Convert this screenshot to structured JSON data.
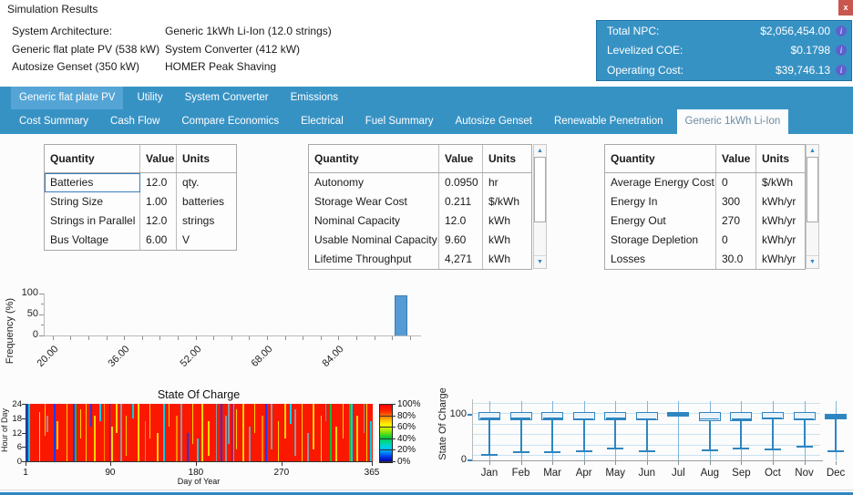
{
  "window": {
    "title": "Simulation Results",
    "close_label": "x"
  },
  "architecture": {
    "rows_left": [
      "System Architecture:",
      "Generic flat plate PV (538 kW)",
      "Autosize Genset (350 kW)"
    ],
    "rows_right": [
      "Generic 1kWh Li-Ion (12.0 strings)",
      "System Converter (412 kW)",
      "HOMER Peak Shaving"
    ]
  },
  "summary": {
    "rows": [
      {
        "label": "Total NPC:",
        "value": "$2,056,454.00"
      },
      {
        "label": "Levelized COE:",
        "value": "$0.1798"
      },
      {
        "label": "Operating Cost:",
        "value": "$39,746.13"
      }
    ],
    "info_icon": "i",
    "accent_color": "#3792C4"
  },
  "tabs": {
    "row1": [
      {
        "label": "Generic flat plate PV",
        "selected": true
      },
      {
        "label": "Utility",
        "selected": false
      },
      {
        "label": "System Converter",
        "selected": false
      },
      {
        "label": "Emissions",
        "selected": false
      }
    ],
    "row2": [
      {
        "label": "Cost Summary",
        "selected": false
      },
      {
        "label": "Cash Flow",
        "selected": false
      },
      {
        "label": "Compare Economics",
        "selected": false
      },
      {
        "label": "Electrical",
        "selected": false
      },
      {
        "label": "Fuel Summary",
        "selected": false
      },
      {
        "label": "Autosize Genset",
        "selected": false
      },
      {
        "label": "Renewable Penetration",
        "selected": false
      },
      {
        "label": "Generic 1kWh Li-Ion",
        "selected": true
      }
    ]
  },
  "tables": [
    {
      "headers": [
        "Quantity",
        "Value",
        "Units"
      ],
      "rows": [
        [
          "Batteries",
          "12.0",
          "qty."
        ],
        [
          "String Size",
          "1.00",
          "batteries"
        ],
        [
          "Strings in Parallel",
          "12.0",
          "strings"
        ],
        [
          "Bus Voltage",
          "6.00",
          "V"
        ]
      ],
      "focused_cell": [
        0,
        0
      ],
      "scrollbar": false
    },
    {
      "headers": [
        "Quantity",
        "Value",
        "Units"
      ],
      "rows": [
        [
          "Autonomy",
          "0.0950",
          "hr"
        ],
        [
          "Storage Wear Cost",
          "0.211",
          "$/kWh"
        ],
        [
          "Nominal Capacity",
          "12.0",
          "kWh"
        ],
        [
          "Usable Nominal Capacity",
          "9.60",
          "kWh"
        ],
        [
          "Lifetime Throughput",
          "4,271",
          "kWh"
        ]
      ],
      "scrollbar": true
    },
    {
      "headers": [
        "Quantity",
        "Value",
        "Units"
      ],
      "rows": [
        [
          "Average Energy Cost",
          "0",
          "$/kWh"
        ],
        [
          "Energy In",
          "300",
          "kWh/yr"
        ],
        [
          "Energy Out",
          "270",
          "kWh/yr"
        ],
        [
          "Storage Depletion",
          "0",
          "kWh/yr"
        ],
        [
          "Losses",
          "30.0",
          "kWh/yr"
        ]
      ],
      "scrollbar": true
    }
  ],
  "chart_data": [
    {
      "type": "bar",
      "subtype": "histogram",
      "title": "",
      "ylabel": "Frequency (%)",
      "xlabel": "",
      "ylim": [
        0,
        100
      ],
      "y_ticks": [
        0,
        50,
        100
      ],
      "x_range": [
        18,
        102
      ],
      "x_tick_step": 4,
      "x_tick_labels": [
        "20.00",
        "36.00",
        "52.00",
        "68.00",
        "84.00"
      ],
      "x_tick_label_values": [
        20,
        36,
        52,
        68,
        84
      ],
      "bars": [
        {
          "x_center": 98,
          "bin_width": 2.7,
          "value": 95
        }
      ],
      "bar_color": "#579BD5"
    },
    {
      "type": "heatmap",
      "title": "State Of Charge",
      "xlabel": "Day of Year",
      "ylabel": "Hour of Day",
      "x_ticks": [
        1,
        90,
        180,
        270,
        365
      ],
      "y_ticks": [
        0,
        6,
        12,
        18,
        24
      ],
      "legend_labels": [
        "100%",
        "80%",
        "60%",
        "40%",
        "20%",
        "0%"
      ],
      "base_value": "~100% state of charge most of year",
      "base_color": "#FB1800",
      "palette": {
        "Y": "#FFD400",
        "O": "#FF8A00",
        "B": "#2438E8",
        "C": "#00CFE8",
        "G": "#18B83C",
        "N": "#8C98A4"
      },
      "streaks": [
        [
          1,
          "B",
          0,
          1
        ],
        [
          3,
          "C",
          0,
          1
        ],
        [
          14,
          "Y",
          0.15,
          1
        ],
        [
          20,
          "Y",
          0,
          0.55
        ],
        [
          22,
          "N",
          0.2,
          0.5
        ],
        [
          30,
          "B",
          0,
          1
        ],
        [
          33,
          "Y",
          0.3,
          0.8
        ],
        [
          43,
          "Y",
          0,
          1
        ],
        [
          50,
          "B",
          0,
          1
        ],
        [
          52,
          "G",
          0,
          1
        ],
        [
          57,
          "Y",
          0.1,
          0.6
        ],
        [
          63,
          "Y",
          0,
          1
        ],
        [
          68,
          "B",
          0,
          0.4
        ],
        [
          72,
          "Y",
          0.2,
          1
        ],
        [
          78,
          "C",
          0,
          0.3
        ],
        [
          82,
          "O",
          0,
          1
        ],
        [
          88,
          "B",
          0,
          1
        ],
        [
          90,
          "Y",
          0.4,
          1
        ],
        [
          95,
          "Y",
          0,
          0.5
        ],
        [
          100,
          "N",
          0,
          1
        ],
        [
          105,
          "Y",
          0.2,
          0.9
        ],
        [
          112,
          "C",
          0,
          0.25
        ],
        [
          118,
          "Y",
          0,
          1
        ],
        [
          125,
          "N",
          0.3,
          1
        ],
        [
          130,
          "Y",
          0,
          0.6
        ],
        [
          138,
          "Y",
          0.5,
          1
        ],
        [
          145,
          "C",
          0,
          1
        ],
        [
          150,
          "Y",
          0,
          0.4
        ],
        [
          158,
          "O",
          0.2,
          1
        ],
        [
          163,
          "N",
          0,
          1
        ],
        [
          170,
          "B",
          0.5,
          1
        ],
        [
          175,
          "Y",
          0,
          0.7
        ],
        [
          180,
          "C",
          0.6,
          1
        ],
        [
          185,
          "Y",
          0,
          1
        ],
        [
          192,
          "Y",
          0.3,
          0.9
        ],
        [
          200,
          "N",
          0,
          1
        ],
        [
          205,
          "B",
          0,
          1
        ],
        [
          210,
          "N",
          0.2,
          1
        ],
        [
          213,
          "N",
          0,
          0.7
        ],
        [
          216,
          "B",
          0,
          1
        ],
        [
          218,
          "N",
          0,
          1
        ],
        [
          221,
          "Y",
          0.1,
          0.8
        ],
        [
          228,
          "Y",
          0,
          1
        ],
        [
          235,
          "N",
          0.4,
          1
        ],
        [
          240,
          "Y",
          0,
          0.5
        ],
        [
          248,
          "O",
          0.2,
          1
        ],
        [
          252,
          "B",
          0,
          1
        ],
        [
          258,
          "N",
          0,
          0.8
        ],
        [
          265,
          "Y",
          0.3,
          1
        ],
        [
          272,
          "Y",
          0,
          0.6
        ],
        [
          278,
          "C",
          0,
          0.35
        ],
        [
          283,
          "N",
          0.1,
          0.9
        ],
        [
          290,
          "Y",
          0,
          1
        ],
        [
          296,
          "N",
          0.5,
          1
        ],
        [
          302,
          "Y",
          0,
          0.8
        ],
        [
          310,
          "Y",
          0.2,
          1
        ],
        [
          315,
          "C",
          0,
          0.3
        ],
        [
          320,
          "G",
          0,
          1
        ],
        [
          326,
          "Y",
          0.4,
          1
        ],
        [
          333,
          "Y",
          0,
          0.6
        ],
        [
          340,
          "G",
          0,
          1
        ],
        [
          342,
          "C",
          0,
          1
        ],
        [
          348,
          "Y",
          0.2,
          1
        ],
        [
          355,
          "N",
          0,
          0.5
        ],
        [
          358,
          "Y",
          0,
          1
        ],
        [
          362,
          "C",
          0.3,
          1
        ]
      ]
    },
    {
      "type": "boxplot",
      "ylabel": "State Of Charge",
      "xlabel": "",
      "ylim": [
        0,
        125
      ],
      "y_ticks": [
        0,
        100
      ],
      "categories": [
        "Jan",
        "Feb",
        "Mar",
        "Apr",
        "May",
        "Jun",
        "Jul",
        "Aug",
        "Sep",
        "Oct",
        "Nov",
        "Dec"
      ],
      "stats": [
        {
          "min": 15,
          "q1": 90,
          "med": 96,
          "q3": 100,
          "max": 100
        },
        {
          "min": 20,
          "q1": 90,
          "med": 96,
          "q3": 100,
          "max": 100
        },
        {
          "min": 21,
          "q1": 91,
          "med": 96,
          "q3": 100,
          "max": 100
        },
        {
          "min": 23,
          "q1": 90,
          "med": 95,
          "q3": 100,
          "max": 100
        },
        {
          "min": 28,
          "q1": 91,
          "med": 96,
          "q3": 100,
          "max": 100
        },
        {
          "min": 22,
          "q1": 90,
          "med": 95,
          "q3": 100,
          "max": 100
        },
        {
          "min": 97,
          "q1": 99,
          "med": 100,
          "q3": 100,
          "max": 100
        },
        {
          "min": 25,
          "q1": 89,
          "med": 95,
          "q3": 100,
          "max": 100
        },
        {
          "min": 29,
          "q1": 89,
          "med": 94,
          "q3": 100,
          "max": 100
        },
        {
          "min": 27,
          "q1": 93,
          "med": 96,
          "q3": 100,
          "max": 100
        },
        {
          "min": 33,
          "q1": 90,
          "med": 95,
          "q3": 100,
          "max": 100
        },
        {
          "min": 22,
          "q1": 93,
          "med": 95,
          "q3": 97,
          "max": 100
        }
      ],
      "box_color": "#2E86C1"
    }
  ]
}
